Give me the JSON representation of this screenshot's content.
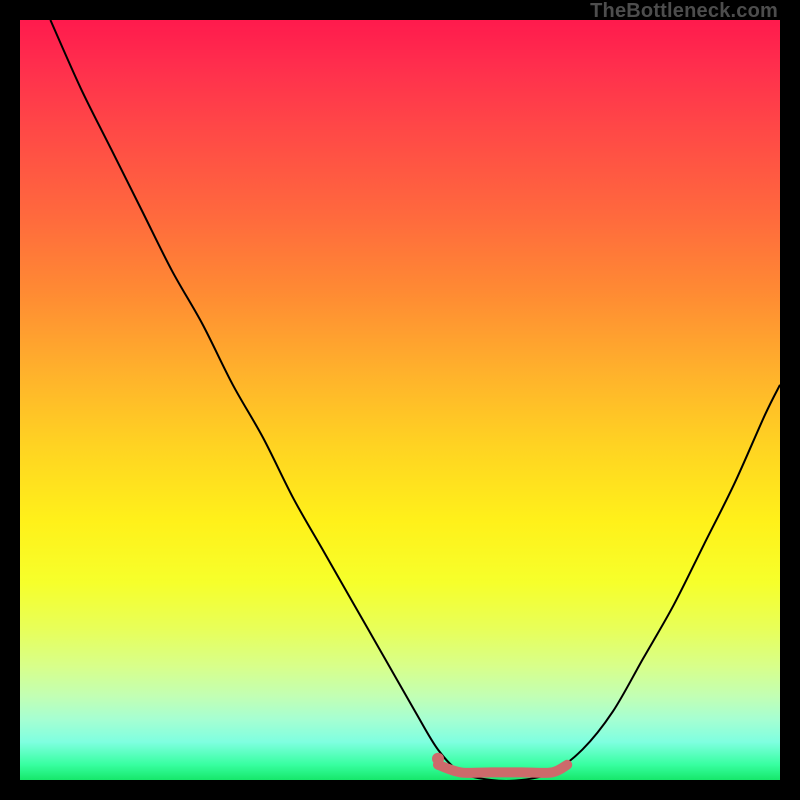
{
  "watermark": "TheBottleneck.com",
  "chart_data": {
    "type": "line",
    "title": "",
    "xlabel": "",
    "ylabel": "",
    "xlim": [
      0,
      100
    ],
    "ylim": [
      0,
      100
    ],
    "grid": false,
    "legend": false,
    "description": "Bottleneck percentage curve on a rainbow gradient background; V-shaped black curve reaching a minimum near x≈63 with a short coral flat segment marking the low-bottleneck zone.",
    "series": [
      {
        "name": "bottleneck-curve",
        "color": "#000000",
        "points": [
          {
            "x": 4,
            "y": 100
          },
          {
            "x": 8,
            "y": 91
          },
          {
            "x": 12,
            "y": 83
          },
          {
            "x": 16,
            "y": 75
          },
          {
            "x": 20,
            "y": 67
          },
          {
            "x": 24,
            "y": 60
          },
          {
            "x": 28,
            "y": 52
          },
          {
            "x": 32,
            "y": 45
          },
          {
            "x": 36,
            "y": 37
          },
          {
            "x": 40,
            "y": 30
          },
          {
            "x": 44,
            "y": 23
          },
          {
            "x": 48,
            "y": 16
          },
          {
            "x": 52,
            "y": 9
          },
          {
            "x": 55,
            "y": 4
          },
          {
            "x": 58,
            "y": 1
          },
          {
            "x": 62,
            "y": 0
          },
          {
            "x": 66,
            "y": 0
          },
          {
            "x": 70,
            "y": 1
          },
          {
            "x": 74,
            "y": 4
          },
          {
            "x": 78,
            "y": 9
          },
          {
            "x": 82,
            "y": 16
          },
          {
            "x": 86,
            "y": 23
          },
          {
            "x": 90,
            "y": 31
          },
          {
            "x": 94,
            "y": 39
          },
          {
            "x": 98,
            "y": 48
          },
          {
            "x": 100,
            "y": 52
          }
        ]
      },
      {
        "name": "low-bottleneck-marker",
        "color": "#cd6a6b",
        "points": [
          {
            "x": 55,
            "y": 2
          },
          {
            "x": 58,
            "y": 1
          },
          {
            "x": 62,
            "y": 1
          },
          {
            "x": 66,
            "y": 1
          },
          {
            "x": 70,
            "y": 1
          },
          {
            "x": 72,
            "y": 2
          }
        ]
      }
    ],
    "marker_dot": {
      "x": 55,
      "y": 2.8,
      "color": "#cd6a6b"
    }
  }
}
